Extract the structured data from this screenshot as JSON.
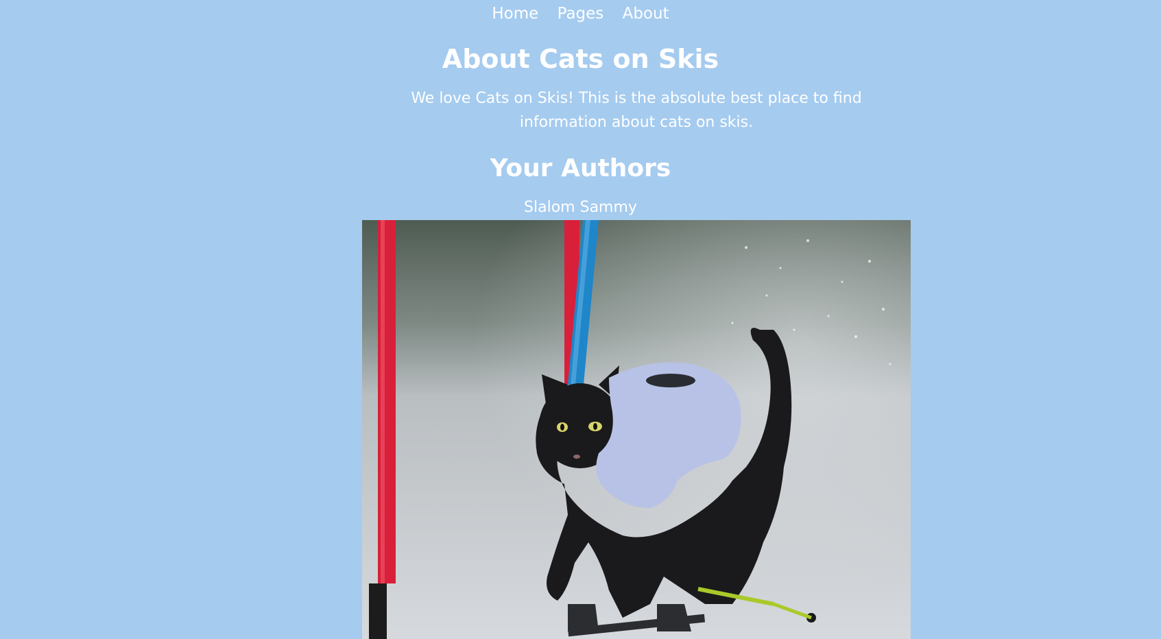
{
  "nav": {
    "items": [
      {
        "label": "Home"
      },
      {
        "label": "Pages"
      },
      {
        "label": "About"
      }
    ]
  },
  "main": {
    "title": "About Cats on Skis",
    "intro": "We love Cats on Skis! This is the absolute best place to find information about cats on skis.",
    "authors_heading": "Your Authors",
    "authors": [
      {
        "name": "Slalom Sammy"
      }
    ]
  },
  "colors": {
    "background": "#a5cbef",
    "text": "#ffffff"
  }
}
